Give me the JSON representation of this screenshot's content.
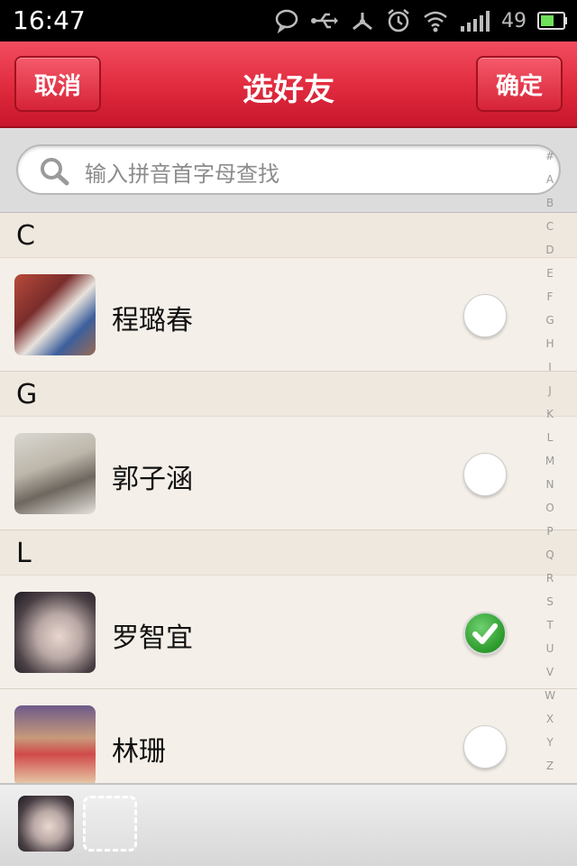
{
  "status_bar": {
    "time": "16:47",
    "battery": "49",
    "icons": [
      "chat-bubble-icon",
      "usb-icon",
      "tether-icon",
      "alarm-icon",
      "wifi-icon",
      "signal-icon",
      "battery-icon"
    ]
  },
  "header": {
    "title": "选好友",
    "cancel_label": "取消",
    "confirm_label": "确定",
    "accent_color": "#e02a3d"
  },
  "search": {
    "placeholder": "输入拼音首字母查找"
  },
  "sections": [
    {
      "letter": "C",
      "contacts": [
        {
          "name": "程璐春",
          "selected": false
        }
      ]
    },
    {
      "letter": "G",
      "contacts": [
        {
          "name": "郭子涵",
          "selected": false
        }
      ]
    },
    {
      "letter": "L",
      "contacts": [
        {
          "name": "罗智宜",
          "selected": true
        },
        {
          "name": "林珊",
          "selected": false
        }
      ]
    }
  ],
  "index_letters": [
    "#",
    "A",
    "B",
    "C",
    "D",
    "E",
    "F",
    "G",
    "H",
    "I",
    "J",
    "K",
    "L",
    "M",
    "N",
    "O",
    "P",
    "Q",
    "R",
    "S",
    "T",
    "U",
    "V",
    "W",
    "X",
    "Y",
    "Z"
  ],
  "selection_bar": {
    "selected_count": 1
  }
}
